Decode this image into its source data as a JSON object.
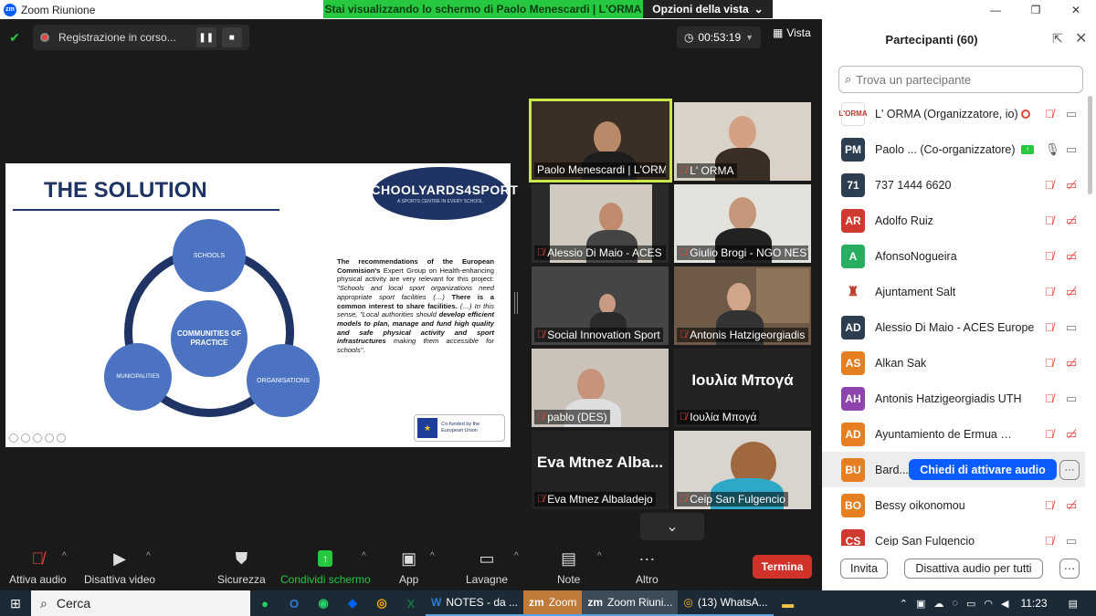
{
  "app": {
    "title": "Zoom Riunione",
    "logo": "zm"
  },
  "banner": {
    "sharing_text": "Stai visualizzando lo schermo di Paolo Menescardi | L'ORMA",
    "view_options": "Opzioni della vista"
  },
  "recording": {
    "label": "Registrazione in corso..."
  },
  "timer": {
    "value": "00:53:19"
  },
  "view": {
    "label": "Vista"
  },
  "slide": {
    "title": "THE SOLUTION",
    "logo_main": "SCHOOLYARDS4SPORT",
    "logo_sub": "A SPORTS CENTRE IN EVERY SCHOOL",
    "circles": {
      "schools": "SCHOOLS",
      "center": "COMMUNITIES OF PRACTICE",
      "municipalities": "MUNICIPALITIES",
      "organisations": "ORGANISATIONS"
    },
    "text_bold1": "The recommendations of the European Commision's",
    "text_p1": " Expert Group on Health-enhancing physical activity are very relevant for this project: ",
    "text_i1": "\"Schools and local sport organizations need appropriate sport facilities (…)",
    "text_bold2": " There is a common interest to share facilities.",
    "text_i2": " (…) In this sense, \"Local authorities should ",
    "text_bold3": "develop efficient models to plan, manage and fund high quality and safe physical activity and sport infrastructures",
    "text_i3": " making them accessible for schools\".",
    "eu_text": "Co-funded by the European Union"
  },
  "tiles": [
    {
      "name": "Paolo Menescardi | L'ORMA",
      "muted": false,
      "speaker": true
    },
    {
      "name": "L' ORMA",
      "muted": true
    },
    {
      "name": "Alessio Di Maio - ACES Europe",
      "muted": true
    },
    {
      "name": "Giulio Brogi - NGO NEST",
      "muted": true
    },
    {
      "name": "Social Innovation Sport",
      "muted": true
    },
    {
      "name": "Antonis Hatzigeorgiadis UTH",
      "muted": true
    },
    {
      "name": "pablo (DES)",
      "muted": true
    },
    {
      "name": "Ιουλία Μπογά",
      "muted": true,
      "big": "Ιουλία Μπογά"
    },
    {
      "name": "Eva Mtnez Albaladejo",
      "muted": true,
      "big": "Eva Mtnez Alba..."
    },
    {
      "name": "Ceip San Fulgencio",
      "muted": true
    }
  ],
  "toolbar": {
    "mute": "Attiva audio",
    "video": "Disattiva video",
    "security": "Sicurezza",
    "share": "Condividi schermo",
    "apps": "App",
    "whiteboard": "Lavagne",
    "notes": "Note",
    "more": "Altro",
    "end": "Termina"
  },
  "participants": {
    "title": "Partecipanti (60)",
    "search_placeholder": "Trova un partecipante",
    "list": [
      {
        "initials": "",
        "name": "L' ORMA (Organizzatore, io)",
        "color": "#ffffff",
        "logo": true
      },
      {
        "initials": "PM",
        "name": "Paolo ...   (Co-organizzatore)",
        "color": "#2c3e50"
      },
      {
        "initials": "71",
        "name": "737 1444 6620",
        "color": "#2c3e50"
      },
      {
        "initials": "AR",
        "name": "Adolfo Ruiz",
        "color": "#d0392f"
      },
      {
        "initials": "A",
        "name": "AfonsoNogueira",
        "color": "#27ae60"
      },
      {
        "initials": "",
        "name": "Ajuntament Salt",
        "color": "#ffffff",
        "logo": true
      },
      {
        "initials": "AD",
        "name": "Alessio Di Maio - ACES Europe",
        "color": "#2c3e50"
      },
      {
        "initials": "AS",
        "name": "Alkan Sak",
        "color": "#e67e22"
      },
      {
        "initials": "AH",
        "name": "Antonis Hatzigeorgiadis UTH",
        "color": "#8e44ad"
      },
      {
        "initials": "AD",
        "name": "Ayuntamiento de Ermua | Ermu...",
        "color": "#e67e22"
      },
      {
        "initials": "BU",
        "name": "Bard...",
        "color": "#e67e22"
      },
      {
        "initials": "BO",
        "name": "Bessy oikonomou",
        "color": "#e67e22"
      },
      {
        "initials": "CS",
        "name": "Ceip San Fulgencio",
        "color": "#d0392f"
      }
    ],
    "ask_unmute": "Chiedi di attivare audio",
    "invite": "Invita",
    "mute_all": "Disattiva audio per tutti",
    "more": "···"
  },
  "taskbar": {
    "search": "Cerca",
    "apps": [
      "NOTES - da ...",
      "Zoom",
      "Zoom Riuni...",
      "(13) WhatsA..."
    ],
    "time": "11:23"
  }
}
